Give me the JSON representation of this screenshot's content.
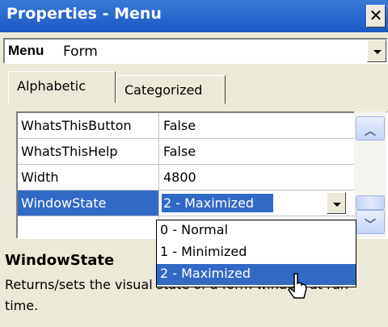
{
  "window": {
    "title": "Properties - Menu",
    "close_glyph": "✕"
  },
  "object_selector": {
    "name": "Menu",
    "type": "Form"
  },
  "tabs": [
    {
      "label": "Alphabetic",
      "active": true
    },
    {
      "label": "Categorized",
      "active": false
    }
  ],
  "properties": [
    {
      "name": "WhatsThisButton",
      "value": "False"
    },
    {
      "name": "WhatsThisHelp",
      "value": "False"
    },
    {
      "name": "Width",
      "value": "4800"
    },
    {
      "name": "WindowState",
      "value": "2 - Maximized",
      "selected": true
    }
  ],
  "dropdown": {
    "options": [
      "0 - Normal",
      "1 - Minimized",
      "2 - Maximized"
    ],
    "selected_index": 2
  },
  "description": {
    "title": "WindowState",
    "text": "Returns/sets the visual state of a form window at run time."
  },
  "colors": {
    "titlebar": "#2b6cd0",
    "selection": "#316ac5",
    "panel": "#ece9d8"
  },
  "icons": {
    "close": "close-icon",
    "dropdown": "chevron-down-icon",
    "scroll_up": "chevron-up-icon",
    "scroll_down": "chevron-down-icon",
    "cursor": "pointer-cursor-icon"
  }
}
